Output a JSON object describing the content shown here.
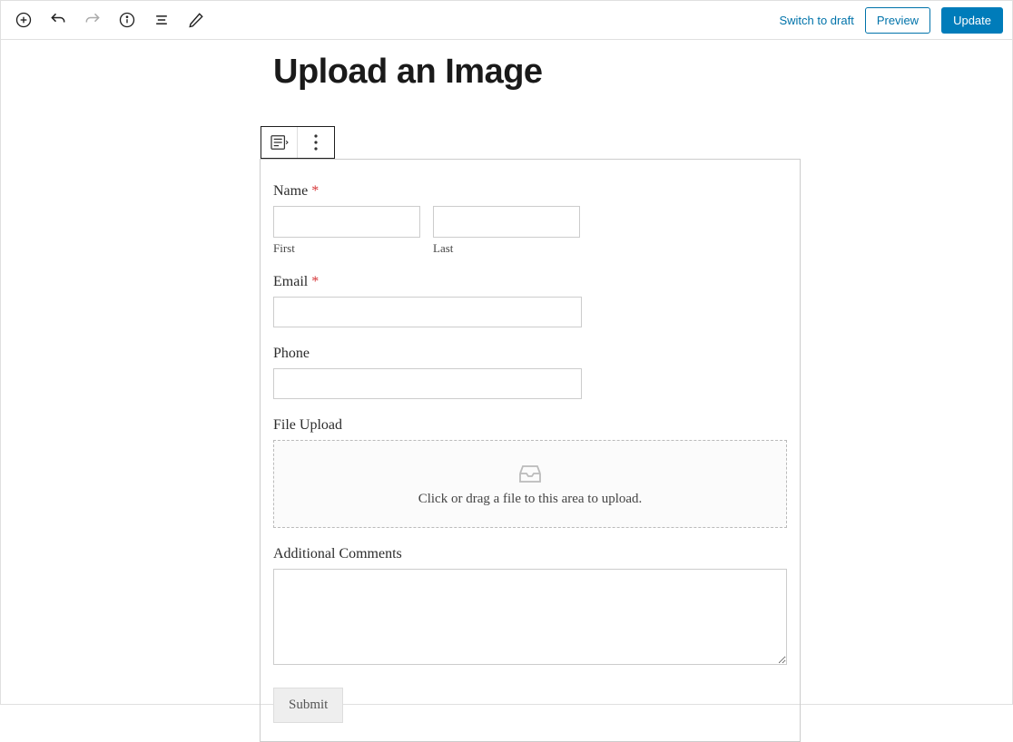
{
  "toolbar": {
    "switch_draft": "Switch to draft",
    "preview": "Preview",
    "update": "Update"
  },
  "page": {
    "title": "Upload an Image"
  },
  "form": {
    "name": {
      "label": "Name",
      "first_sub": "First",
      "last_sub": "Last"
    },
    "email": {
      "label": "Email"
    },
    "phone": {
      "label": "Phone"
    },
    "file": {
      "label": "File Upload",
      "hint": "Click or drag a file to this area to upload."
    },
    "comments": {
      "label": "Additional Comments"
    },
    "submit": "Submit"
  }
}
